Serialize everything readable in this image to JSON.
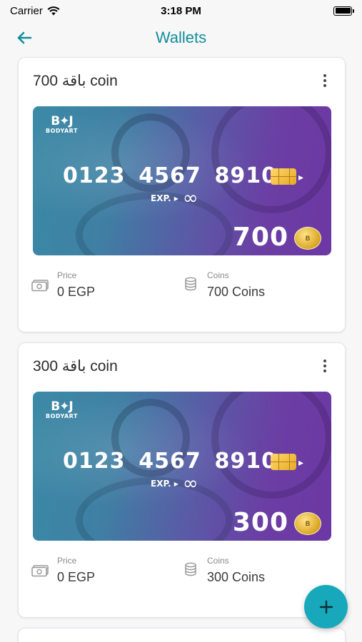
{
  "status_bar": {
    "carrier": "Carrier",
    "time": "3:18 PM"
  },
  "nav": {
    "title": "Wallets",
    "back_icon": "arrow-left-icon"
  },
  "accent_color": "#138d9b",
  "fab_color": "#18a8bb",
  "wallets": [
    {
      "title": "باقة 700 coin",
      "card": {
        "brand": "BODYART",
        "number_groups": [
          "0123",
          "4567",
          "8910"
        ],
        "expiry_label": "EXP. ▸",
        "expiry_value": "∞",
        "amount": "700"
      },
      "price_label": "Price",
      "price_value": "0 EGP",
      "coins_label": "Coins",
      "coins_value": "700 Coins"
    },
    {
      "title": "باقة 300 coin",
      "card": {
        "brand": "BODYART",
        "number_groups": [
          "0123",
          "4567",
          "8910"
        ],
        "expiry_label": "EXP. ▸",
        "expiry_value": "∞",
        "amount": "300"
      },
      "price_label": "Price",
      "price_value": "0 EGP",
      "coins_label": "Coins",
      "coins_value": "300 Coins"
    }
  ],
  "fab": {
    "icon": "plus-icon"
  }
}
